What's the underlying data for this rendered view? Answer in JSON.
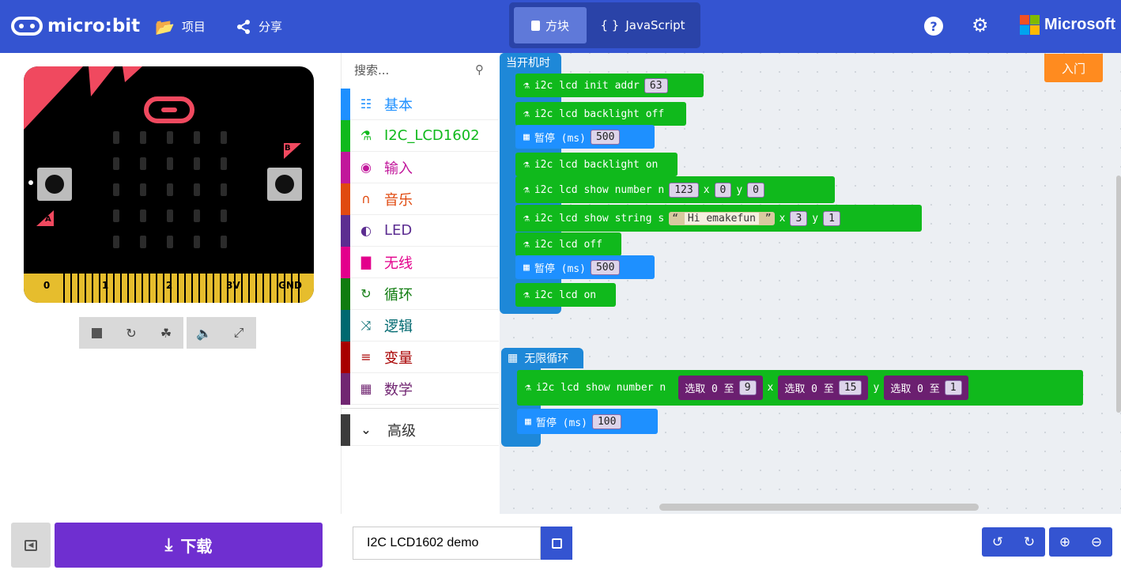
{
  "header": {
    "logo": "micro:bit",
    "projects": "项目",
    "share": "分享",
    "blocks_tab": "方块",
    "js_tab": "JavaScript",
    "brand": "Microsoft"
  },
  "sim": {
    "pins": [
      "0",
      "1",
      "2",
      "3V",
      "GND"
    ],
    "button_a": "A",
    "button_b": "B"
  },
  "toolbox": {
    "search_placeholder": "搜索...",
    "categories": [
      {
        "label": "基本",
        "color": "#1e90ff",
        "icon": "grid-icon"
      },
      {
        "label": "I2C_LCD1602",
        "color": "#10b91c",
        "icon": "flask-icon"
      },
      {
        "label": "输入",
        "color": "#c1179b",
        "icon": "target-icon"
      },
      {
        "label": "音乐",
        "color": "#e04a10",
        "icon": "headphones-icon"
      },
      {
        "label": "LED",
        "color": "#5c2d91",
        "icon": "toggle-icon"
      },
      {
        "label": "无线",
        "color": "#e3008c",
        "icon": "signal-icon"
      },
      {
        "label": "循环",
        "color": "#107c10",
        "icon": "loop-icon"
      },
      {
        "label": "逻辑",
        "color": "#006970",
        "icon": "shuffle-icon"
      },
      {
        "label": "变量",
        "color": "#a80000",
        "icon": "lines-icon"
      },
      {
        "label": "数学",
        "color": "#712672",
        "icon": "calculator-icon"
      }
    ],
    "advanced": "高级"
  },
  "workspace": {
    "on_start": "当开机时",
    "forever": "无限循环",
    "get_started": "入门",
    "start_blocks": [
      {
        "text": "i2c lcd init addr",
        "args": [
          "63"
        ]
      },
      {
        "text": "i2c lcd backlight off",
        "args": []
      },
      {
        "text": "暂停 (ms)",
        "args": [
          "500"
        ]
      },
      {
        "text": "i2c lcd backlight on",
        "args": []
      },
      {
        "text": "i2c lcd show number n",
        "args": [
          "123",
          "x",
          "0",
          "y",
          "0"
        ]
      },
      {
        "text": "i2c lcd show string s",
        "args": [
          "Hi emakefun",
          "x",
          "3",
          "y",
          "1"
        ]
      },
      {
        "text": "i2c lcd off",
        "args": []
      },
      {
        "text": "暂停 (ms)",
        "args": [
          "500"
        ]
      },
      {
        "text": "i2c lcd on",
        "args": []
      }
    ],
    "forever_show": "i2c lcd show number n",
    "random_label": "选取 0 至",
    "random_max": [
      "9",
      "15",
      "1"
    ],
    "x_label": "x",
    "y_label": "y",
    "pause_label": "暂停 (ms)",
    "pause_val": "100"
  },
  "footer": {
    "download": "下载",
    "project_name": "I2C LCD1602 demo"
  }
}
